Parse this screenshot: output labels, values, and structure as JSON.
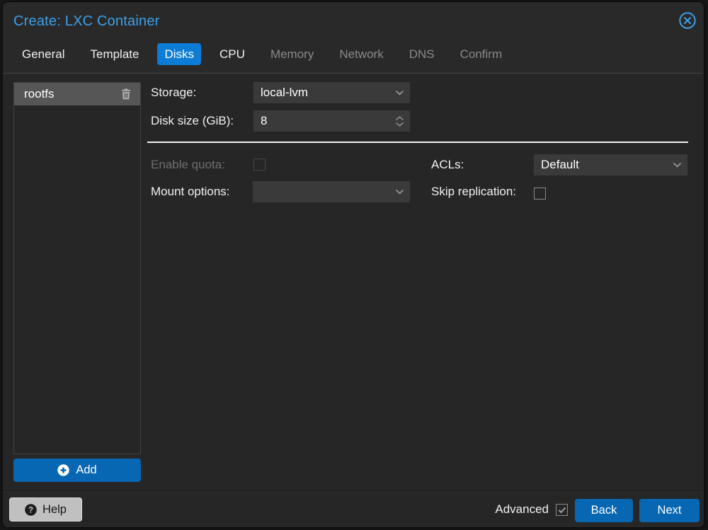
{
  "window": {
    "title": "Create: LXC Container",
    "close_icon": "circle-x-icon"
  },
  "tabs": [
    {
      "label": "General",
      "state": "enabled"
    },
    {
      "label": "Template",
      "state": "enabled"
    },
    {
      "label": "Disks",
      "state": "active"
    },
    {
      "label": "CPU",
      "state": "enabled"
    },
    {
      "label": "Memory",
      "state": "disabled"
    },
    {
      "label": "Network",
      "state": "disabled"
    },
    {
      "label": "DNS",
      "state": "disabled"
    },
    {
      "label": "Confirm",
      "state": "disabled"
    }
  ],
  "mount_points": {
    "items": [
      {
        "name": "rootfs",
        "selected": true
      }
    ],
    "add_label": "Add"
  },
  "form": {
    "storage": {
      "label": "Storage:",
      "value": "local-lvm",
      "type": "combo"
    },
    "disk_size": {
      "label": "Disk size (GiB):",
      "value": "8",
      "type": "number"
    },
    "enable_quota": {
      "label": "Enable quota:",
      "checked": false,
      "disabled": true
    },
    "mount_options": {
      "label": "Mount options:",
      "value": "",
      "type": "combo"
    },
    "acls": {
      "label": "ACLs:",
      "value": "Default",
      "type": "combo"
    },
    "skip_replication": {
      "label": "Skip replication:",
      "checked": false,
      "disabled": false
    }
  },
  "footer": {
    "help_label": "Help",
    "advanced_label": "Advanced",
    "advanced_checked": true,
    "back_label": "Back",
    "next_label": "Next"
  },
  "colors": {
    "accent_blue": "#0767b2",
    "active_tab_blue": "#0c7cd6",
    "title_blue": "#3d9fe8",
    "body_bg": "#262626",
    "field_bg": "#3a3a3a",
    "selected_row": "#565656"
  }
}
